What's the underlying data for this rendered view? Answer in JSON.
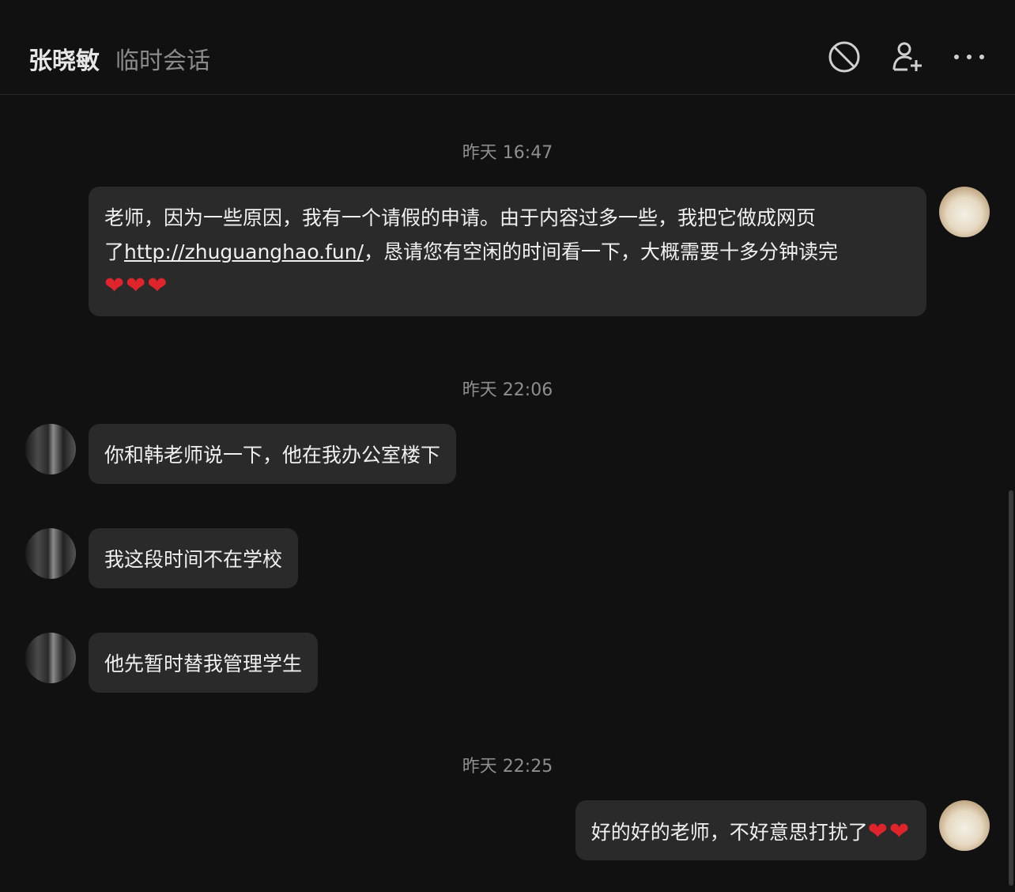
{
  "header": {
    "contact_name": "张晓敏",
    "session_type": "临时会话",
    "icons": [
      "block-icon",
      "add-friend-icon",
      "more-icon"
    ]
  },
  "messages": {
    "ts1": "昨天 16:47",
    "m1_line1": "老师，因为一些原因，我有一个请假的申请。由于内容过多一些，我把它做成网页",
    "m1_line2_prefix": "了",
    "m1_link": "http://zhuguanghao.fun/",
    "m1_line2_suffix": "，恳请您有空闲的时间看一下，大概需要十多分钟读完",
    "m1_hearts": "❤❤❤",
    "ts2": "昨天 22:06",
    "m2": "你和韩老师说一下，他在我办公室楼下",
    "m3": "我这段时间不在学校",
    "m4": "他先暂时替我管理学生",
    "ts3": "昨天 22:25",
    "m5_text": "好的好的老师，不好意思打扰了",
    "m5_hearts": "❤❤"
  },
  "colors": {
    "background": "#111111",
    "bubble": "#2a2a2a",
    "heart": "#e0242c"
  }
}
